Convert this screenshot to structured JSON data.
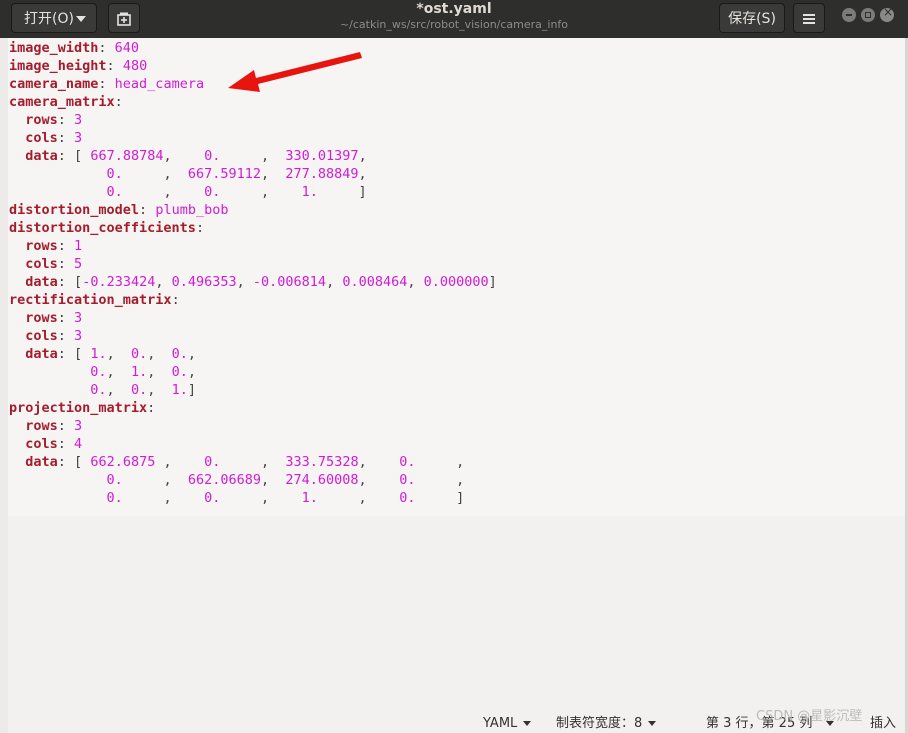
{
  "window": {
    "title": "*ost.yaml",
    "subtitle": "~/catkin_ws/src/robot_vision/camera_info",
    "open_label": "打开(O)",
    "save_label": "保存(S)"
  },
  "editor": {
    "lines": [
      [
        {
          "t": "image_width",
          "c": "k"
        },
        {
          "t": ": ",
          "c": "p"
        },
        {
          "t": "640",
          "c": "v"
        }
      ],
      [
        {
          "t": "image_height",
          "c": "k"
        },
        {
          "t": ": ",
          "c": "p"
        },
        {
          "t": "480",
          "c": "v"
        }
      ],
      [
        {
          "t": "camera_name",
          "c": "k"
        },
        {
          "t": ": ",
          "c": "p"
        },
        {
          "t": "head_camera",
          "c": "v"
        }
      ],
      [
        {
          "t": "camera_matrix",
          "c": "k"
        },
        {
          "t": ":",
          "c": "p"
        }
      ],
      [
        {
          "t": "  rows",
          "c": "k"
        },
        {
          "t": ": ",
          "c": "p"
        },
        {
          "t": "3",
          "c": "v"
        }
      ],
      [
        {
          "t": "  cols",
          "c": "k"
        },
        {
          "t": ": ",
          "c": "p"
        },
        {
          "t": "3",
          "c": "v"
        }
      ],
      [
        {
          "t": "  data",
          "c": "k"
        },
        {
          "t": ": ",
          "c": "p"
        },
        {
          "t": "[ ",
          "c": "p"
        },
        {
          "t": "667.88784",
          "c": "v"
        },
        {
          "t": ",    ",
          "c": "p"
        },
        {
          "t": "0.",
          "c": "v"
        },
        {
          "t": "     ,  ",
          "c": "p"
        },
        {
          "t": "330.01397",
          "c": "v"
        },
        {
          "t": ",",
          "c": "p"
        }
      ],
      [
        {
          "t": "            ",
          "c": "p"
        },
        {
          "t": "0.",
          "c": "v"
        },
        {
          "t": "     ,  ",
          "c": "p"
        },
        {
          "t": "667.59112",
          "c": "v"
        },
        {
          "t": ",  ",
          "c": "p"
        },
        {
          "t": "277.88849",
          "c": "v"
        },
        {
          "t": ",",
          "c": "p"
        }
      ],
      [
        {
          "t": "            ",
          "c": "p"
        },
        {
          "t": "0.",
          "c": "v"
        },
        {
          "t": "     ,    ",
          "c": "p"
        },
        {
          "t": "0.",
          "c": "v"
        },
        {
          "t": "     ,    ",
          "c": "p"
        },
        {
          "t": "1.",
          "c": "v"
        },
        {
          "t": "     ]",
          "c": "p"
        }
      ],
      [
        {
          "t": "distortion_model",
          "c": "k"
        },
        {
          "t": ": ",
          "c": "p"
        },
        {
          "t": "plumb_bob",
          "c": "v"
        }
      ],
      [
        {
          "t": "distortion_coefficients",
          "c": "k"
        },
        {
          "t": ":",
          "c": "p"
        }
      ],
      [
        {
          "t": "  rows",
          "c": "k"
        },
        {
          "t": ": ",
          "c": "p"
        },
        {
          "t": "1",
          "c": "v"
        }
      ],
      [
        {
          "t": "  cols",
          "c": "k"
        },
        {
          "t": ": ",
          "c": "p"
        },
        {
          "t": "5",
          "c": "v"
        }
      ],
      [
        {
          "t": "  data",
          "c": "k"
        },
        {
          "t": ": ",
          "c": "p"
        },
        {
          "t": "[",
          "c": "p"
        },
        {
          "t": "-0.233424",
          "c": "v"
        },
        {
          "t": ", ",
          "c": "p"
        },
        {
          "t": "0.496353",
          "c": "v"
        },
        {
          "t": ", ",
          "c": "p"
        },
        {
          "t": "-0.006814",
          "c": "v"
        },
        {
          "t": ", ",
          "c": "p"
        },
        {
          "t": "0.008464",
          "c": "v"
        },
        {
          "t": ", ",
          "c": "p"
        },
        {
          "t": "0.000000",
          "c": "v"
        },
        {
          "t": "]",
          "c": "p"
        }
      ],
      [
        {
          "t": "rectification_matrix",
          "c": "k"
        },
        {
          "t": ":",
          "c": "p"
        }
      ],
      [
        {
          "t": "  rows",
          "c": "k"
        },
        {
          "t": ": ",
          "c": "p"
        },
        {
          "t": "3",
          "c": "v"
        }
      ],
      [
        {
          "t": "  cols",
          "c": "k"
        },
        {
          "t": ": ",
          "c": "p"
        },
        {
          "t": "3",
          "c": "v"
        }
      ],
      [
        {
          "t": "  data",
          "c": "k"
        },
        {
          "t": ": ",
          "c": "p"
        },
        {
          "t": "[ ",
          "c": "p"
        },
        {
          "t": "1.",
          "c": "v"
        },
        {
          "t": ",  ",
          "c": "p"
        },
        {
          "t": "0.",
          "c": "v"
        },
        {
          "t": ",  ",
          "c": "p"
        },
        {
          "t": "0.",
          "c": "v"
        },
        {
          "t": ",",
          "c": "p"
        }
      ],
      [
        {
          "t": "          ",
          "c": "p"
        },
        {
          "t": "0.",
          "c": "v"
        },
        {
          "t": ",  ",
          "c": "p"
        },
        {
          "t": "1.",
          "c": "v"
        },
        {
          "t": ",  ",
          "c": "p"
        },
        {
          "t": "0.",
          "c": "v"
        },
        {
          "t": ",",
          "c": "p"
        }
      ],
      [
        {
          "t": "          ",
          "c": "p"
        },
        {
          "t": "0.",
          "c": "v"
        },
        {
          "t": ",  ",
          "c": "p"
        },
        {
          "t": "0.",
          "c": "v"
        },
        {
          "t": ",  ",
          "c": "p"
        },
        {
          "t": "1.",
          "c": "v"
        },
        {
          "t": "]",
          "c": "p"
        }
      ],
      [
        {
          "t": "projection_matrix",
          "c": "k"
        },
        {
          "t": ":",
          "c": "p"
        }
      ],
      [
        {
          "t": "  rows",
          "c": "k"
        },
        {
          "t": ": ",
          "c": "p"
        },
        {
          "t": "3",
          "c": "v"
        }
      ],
      [
        {
          "t": "  cols",
          "c": "k"
        },
        {
          "t": ": ",
          "c": "p"
        },
        {
          "t": "4",
          "c": "v"
        }
      ],
      [
        {
          "t": "  data",
          "c": "k"
        },
        {
          "t": ": ",
          "c": "p"
        },
        {
          "t": "[ ",
          "c": "p"
        },
        {
          "t": "662.6875",
          "c": "v"
        },
        {
          "t": " ,    ",
          "c": "p"
        },
        {
          "t": "0.",
          "c": "v"
        },
        {
          "t": "     ,  ",
          "c": "p"
        },
        {
          "t": "333.75328",
          "c": "v"
        },
        {
          "t": ",    ",
          "c": "p"
        },
        {
          "t": "0.",
          "c": "v"
        },
        {
          "t": "     ,",
          "c": "p"
        }
      ],
      [
        {
          "t": "            ",
          "c": "p"
        },
        {
          "t": "0.",
          "c": "v"
        },
        {
          "t": "     ,  ",
          "c": "p"
        },
        {
          "t": "662.06689",
          "c": "v"
        },
        {
          "t": ",  ",
          "c": "p"
        },
        {
          "t": "274.60008",
          "c": "v"
        },
        {
          "t": ",    ",
          "c": "p"
        },
        {
          "t": "0.",
          "c": "v"
        },
        {
          "t": "     ,",
          "c": "p"
        }
      ],
      [
        {
          "t": "            ",
          "c": "p"
        },
        {
          "t": "0.",
          "c": "v"
        },
        {
          "t": "     ,    ",
          "c": "p"
        },
        {
          "t": "0.",
          "c": "v"
        },
        {
          "t": "     ,    ",
          "c": "p"
        },
        {
          "t": "1.",
          "c": "v"
        },
        {
          "t": "     ,    ",
          "c": "p"
        },
        {
          "t": "0.",
          "c": "v"
        },
        {
          "t": "     ]",
          "c": "p"
        }
      ]
    ]
  },
  "statusbar": {
    "language": "YAML",
    "tab_width": "制表符宽度：8",
    "position": "第 3 行，第 25 列",
    "mode": "插入"
  },
  "watermark": "CSDN @星影沉壁",
  "colors": {
    "key": "#a51d2d",
    "value": "#d21bd6",
    "arrow": "#e8150f"
  }
}
